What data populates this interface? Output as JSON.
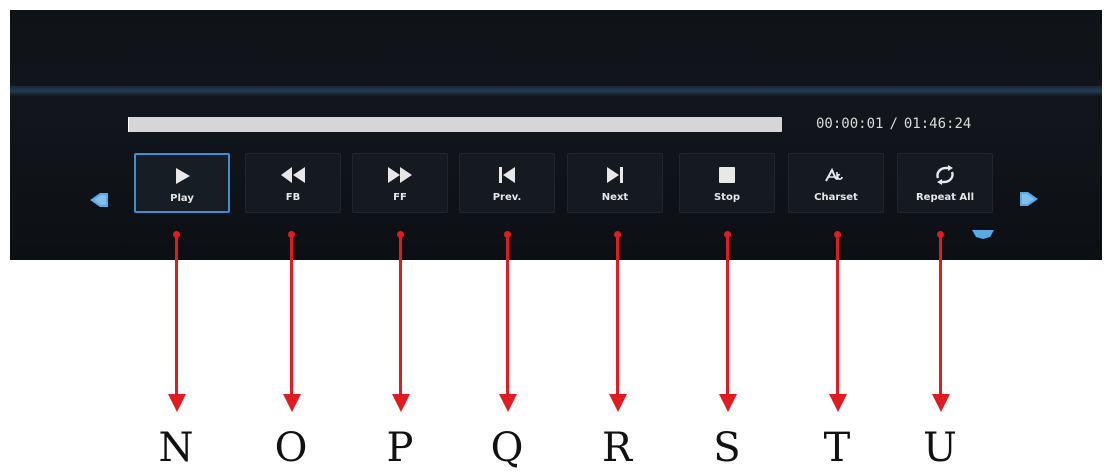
{
  "player": {
    "progress": {
      "current_time": "00:00:01",
      "separator": "/",
      "total_time": "01:46:24",
      "fraction": 0.0002
    },
    "controls": [
      {
        "id": "play",
        "label": "Play",
        "icon": "play-icon",
        "selected": true
      },
      {
        "id": "fb",
        "label": "FB",
        "icon": "fast-backward-icon",
        "selected": false
      },
      {
        "id": "ff",
        "label": "FF",
        "icon": "fast-forward-icon",
        "selected": false
      },
      {
        "id": "prev",
        "label": "Prev.",
        "icon": "skip-previous-icon",
        "selected": false
      },
      {
        "id": "next",
        "label": "Next",
        "icon": "skip-next-icon",
        "selected": false
      },
      {
        "id": "stop",
        "label": "Stop",
        "icon": "stop-icon",
        "selected": false
      },
      {
        "id": "charset",
        "label": "Charset",
        "icon": "charset-icon",
        "selected": false
      },
      {
        "id": "repeat",
        "label": "Repeat All",
        "icon": "repeat-icon",
        "selected": false
      }
    ],
    "nav": {
      "left": "arrow-left-icon",
      "right": "arrow-right-icon",
      "down": "arrow-down-icon"
    },
    "colors": {
      "panel_bg": "#12161c",
      "accent": "#3d8fd2",
      "nav_arrow": "#5aa9e6",
      "callout": "#e11b22"
    }
  },
  "callouts": {
    "letters": [
      "N",
      "O",
      "P",
      "Q",
      "R",
      "S",
      "T",
      "U"
    ]
  }
}
